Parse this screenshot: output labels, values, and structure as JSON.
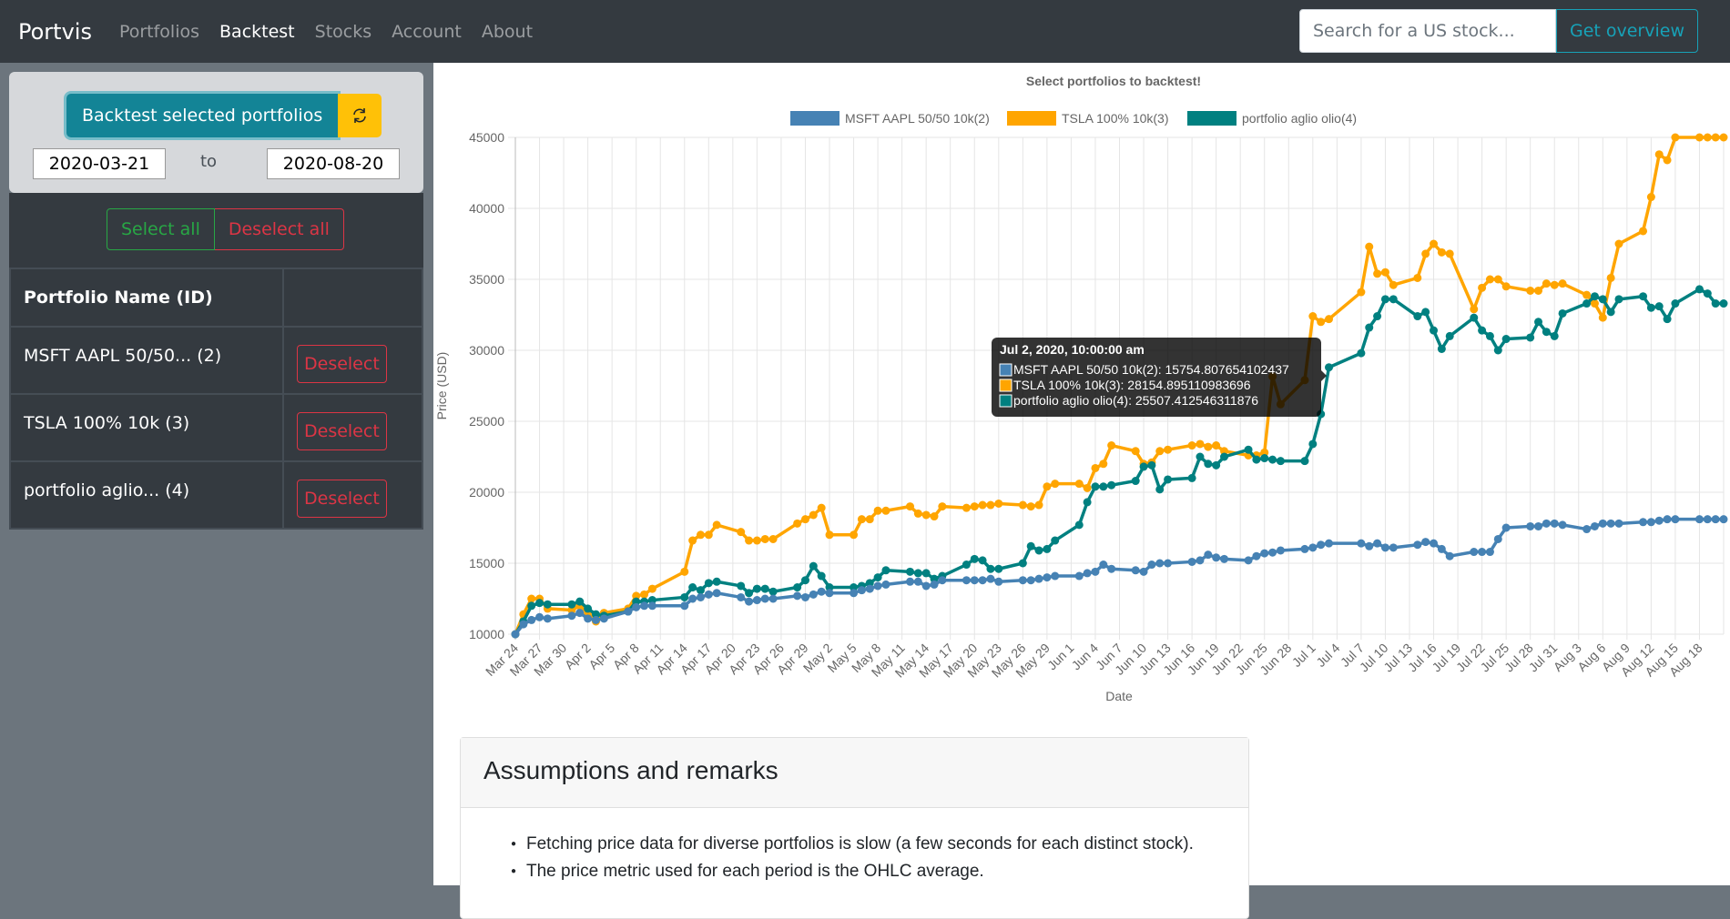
{
  "navbar": {
    "brand": "Portvis",
    "links": [
      {
        "label": "Portfolios",
        "active": false
      },
      {
        "label": "Backtest",
        "active": true
      },
      {
        "label": "Stocks",
        "active": false
      },
      {
        "label": "Account",
        "active": false
      },
      {
        "label": "About",
        "active": false
      }
    ],
    "search_placeholder": "Search for a US stock...",
    "search_value": "",
    "overview_button": "Get overview"
  },
  "sidebar": {
    "backtest_button": "Backtest selected portfolios",
    "refresh_icon": "refresh-icon",
    "date_from": "2020-03-21",
    "to_label": "to",
    "date_to": "2020-08-20",
    "select_all": "Select all",
    "deselect_all": "Deselect all",
    "table_header": "Portfolio Name (ID)",
    "portfolios": [
      {
        "name": "MSFT AAPL 50/50... (2)",
        "action": "Deselect"
      },
      {
        "name": "TSLA 100% 10k (3)",
        "action": "Deselect"
      },
      {
        "name": "portfolio aglio... (4)",
        "action": "Deselect"
      }
    ]
  },
  "remarks": {
    "title": "Assumptions and remarks",
    "items": [
      "Fetching price data for diverse portfolios is slow (a few seconds for each distinct stock).",
      "The price metric used for each period is the OHLC average."
    ]
  },
  "tooltip": {
    "title": "Jul 2, 2020, 10:00:00 am",
    "lines": [
      "MSFT AAPL 50/50 10k(2): 15754.807654102437",
      "TSLA 100% 10k(3): 28154.895110983696",
      "portfolio aglio olio(4): 25507.412546311876"
    ]
  },
  "chart_data": {
    "type": "line",
    "title": "Select portfolios to backtest!",
    "xlabel": "Date",
    "ylabel": "Price (USD)",
    "ylim": [
      10000,
      45000
    ],
    "yticks": [
      10000,
      15000,
      20000,
      25000,
      30000,
      35000,
      40000,
      45000
    ],
    "xrange_days": [
      "2020-03-24",
      "2020-08-21"
    ],
    "xtick_labels": [
      "Mar 24",
      "Mar 27",
      "Mar 30",
      "Apr 2",
      "Apr 5",
      "Apr 8",
      "Apr 11",
      "Apr 14",
      "Apr 17",
      "Apr 20",
      "Apr 23",
      "Apr 26",
      "Apr 29",
      "May 2",
      "May 5",
      "May 8",
      "May 11",
      "May 14",
      "May 17",
      "May 20",
      "May 23",
      "May 26",
      "May 29",
      "Jun 1",
      "Jun 4",
      "Jun 7",
      "Jun 10",
      "Jun 13",
      "Jun 16",
      "Jun 19",
      "Jun 22",
      "Jun 25",
      "Jun 28",
      "Jul 1",
      "Jul 4",
      "Jul 7",
      "Jul 10",
      "Jul 13",
      "Jul 16",
      "Jul 19",
      "Jul 22",
      "Jul 25",
      "Jul 28",
      "Jul 31",
      "Aug 3",
      "Aug 6",
      "Aug 9",
      "Aug 12",
      "Aug 15",
      "Aug 18"
    ],
    "grid": true,
    "legend_position": "top",
    "x_day_offsets": [
      0,
      1,
      2,
      3,
      4,
      7,
      8,
      9,
      10,
      11,
      14,
      15,
      16,
      17,
      21,
      22,
      23,
      24,
      25,
      28,
      29,
      30,
      31,
      32,
      35,
      36,
      37,
      38,
      39,
      42,
      43,
      44,
      45,
      46,
      49,
      50,
      51,
      52,
      53,
      56,
      57,
      58,
      59,
      60,
      63,
      64,
      65,
      66,
      67,
      70,
      71,
      72,
      73,
      74,
      77,
      78,
      79,
      80,
      81,
      84,
      85,
      86,
      87,
      88,
      91,
      92,
      93,
      94,
      95,
      98,
      99,
      100,
      101,
      105,
      106,
      107,
      108,
      109,
      112,
      113,
      114,
      115,
      116,
      119,
      120,
      121,
      122,
      123,
      126,
      127,
      128,
      129,
      130,
      133,
      134,
      135,
      136,
      137,
      140,
      141,
      142,
      143,
      144,
      147,
      148,
      149,
      150
    ],
    "series": [
      {
        "name": "MSFT AAPL 50/50 10k(2)",
        "color": "#4682b4",
        "values": [
          10000,
          10700,
          11000,
          11200,
          11100,
          11300,
          11500,
          11100,
          11000,
          11100,
          11600,
          11900,
          12000,
          12000,
          12000,
          12500,
          12600,
          12800,
          12900,
          12600,
          12300,
          12400,
          12500,
          12500,
          12700,
          12600,
          12800,
          13000,
          12900,
          12900,
          13100,
          13200,
          13400,
          13500,
          13700,
          13700,
          13400,
          13500,
          13800,
          13800,
          13800,
          13800,
          13900,
          13700,
          13800,
          13800,
          13900,
          14000,
          14100,
          14100,
          14300,
          14400,
          14900,
          14600,
          14500,
          14400,
          14900,
          15000,
          15000,
          15100,
          15200,
          15600,
          15400,
          15300,
          15200,
          15500,
          15700,
          15754,
          15900,
          16000,
          16100,
          16300,
          16400,
          16400,
          16200,
          16400,
          16100,
          16100,
          16300,
          16500,
          16400,
          16000,
          15500,
          15800,
          15800,
          15800,
          16700,
          17500,
          17600,
          17600,
          17800,
          17800,
          17700,
          17400,
          17600,
          17800,
          17800,
          17800,
          17900,
          17900,
          18000,
          18100,
          18100,
          18100,
          18100,
          18100,
          18100
        ]
      },
      {
        "name": "TSLA 100% 10k(3)",
        "color": "#ffa500",
        "values": [
          10000,
          11400,
          12500,
          12500,
          11800,
          11700,
          12000,
          11500,
          10900,
          11500,
          11800,
          12700,
          12800,
          13200,
          14400,
          16600,
          17000,
          17000,
          17700,
          17200,
          16600,
          16600,
          16700,
          16700,
          17800,
          18100,
          18400,
          18900,
          17000,
          17000,
          18100,
          18100,
          18700,
          18700,
          19000,
          18500,
          18400,
          18300,
          19000,
          18900,
          19000,
          19100,
          19100,
          19200,
          19100,
          19000,
          19100,
          20400,
          20600,
          20600,
          20300,
          21700,
          22000,
          23300,
          22900,
          22000,
          22100,
          22900,
          23000,
          23300,
          23400,
          23200,
          23300,
          22900,
          22600,
          22600,
          22800,
          28154,
          26200,
          27900,
          32400,
          32000,
          32200,
          34100,
          37300,
          35400,
          35500,
          34600,
          35100,
          36800,
          37500,
          36900,
          36800,
          32900,
          34400,
          35000,
          35000,
          34500,
          34200,
          34200,
          34700,
          34600,
          34700,
          33900,
          33300,
          32300,
          35100,
          37500,
          38400,
          40800,
          43800,
          43400,
          45000,
          45000,
          45000,
          45000,
          45000
        ]
      },
      {
        "name": "portfolio aglio olio(4)",
        "color": "#008080",
        "values": [
          10000,
          10900,
          12000,
          12200,
          12100,
          12100,
          12300,
          11800,
          11400,
          11300,
          11600,
          12300,
          12300,
          12400,
          12600,
          13300,
          13100,
          13600,
          13700,
          13400,
          12900,
          13200,
          13200,
          13000,
          13300,
          13800,
          14800,
          14100,
          13300,
          13300,
          13400,
          13600,
          14000,
          14500,
          14400,
          14300,
          14300,
          13900,
          14100,
          14900,
          15300,
          15200,
          14600,
          14600,
          15000,
          16200,
          15900,
          16000,
          16600,
          17700,
          19300,
          20400,
          20400,
          20500,
          20800,
          21800,
          21900,
          20200,
          20900,
          21000,
          22500,
          22000,
          21900,
          22500,
          23000,
          22300,
          22400,
          22300,
          22200,
          22200,
          23400,
          25507,
          28800,
          29800,
          31600,
          32400,
          33600,
          33600,
          32400,
          32700,
          31400,
          30100,
          31000,
          32300,
          31400,
          31000,
          30000,
          30800,
          30900,
          32000,
          31300,
          31000,
          32600,
          33300,
          33800,
          33600,
          32700,
          33600,
          33800,
          33000,
          33100,
          32200,
          33300,
          34300,
          34000,
          33300,
          33300
        ]
      }
    ]
  }
}
